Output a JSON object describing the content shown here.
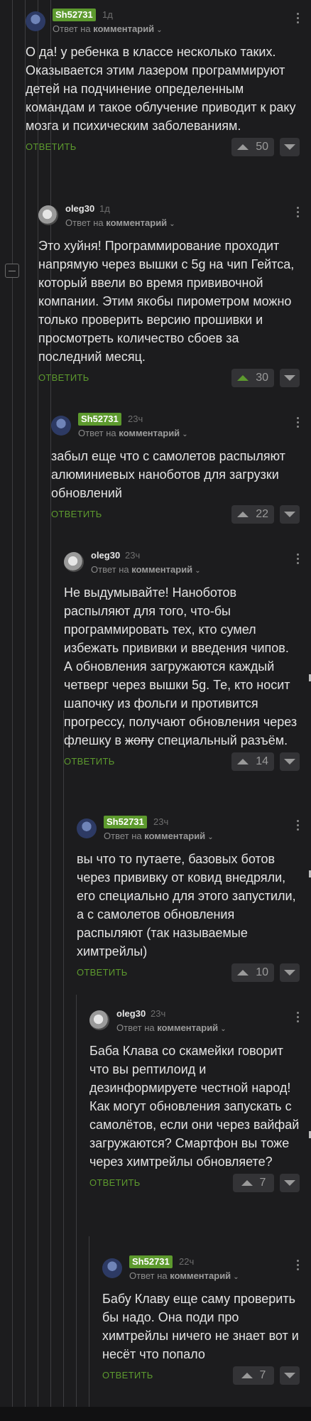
{
  "labels": {
    "reply_to": "Ответ на",
    "reply_target": "комментарий",
    "answer": "ОТВЕТИТЬ"
  },
  "comments": [
    {
      "user": "Sh52731",
      "time": "1д",
      "text": "О да! у ребенка в классе несколько таких. Оказывается этим лазером программируют детей на подчинение определенным командам и такое облучение приводит к раку мозга и психическим заболеваниям.",
      "score": "50",
      "upvoted": false
    },
    {
      "user": "oleg30",
      "time": "1д",
      "text": "Это хуйня! Программирование проходит напрямую через вышки с 5g на чип Гейтса, который ввели во время прививочной компании. Этим якобы пирометром можно только проверить версию прошивки и просмотреть количество сбоев за последний месяц.",
      "score": "30",
      "upvoted": true
    },
    {
      "user": "Sh52731",
      "time": "23ч",
      "text": "забыл еще что с самолетов распыляют алюминиевых наноботов для загрузки обновлений",
      "score": "22",
      "upvoted": false
    },
    {
      "user": "oleg30",
      "time": "23ч",
      "text_before": "Не выдумывайте! Наноботов распыляют для того, что-бы программировать тех, кто сумел избежать прививки и введения чипов. А обновления загружаются каждый четверг через вышки 5g. Те, кто носит шапочку из фольги и противится прогрессу, получают обновления через флешку в ",
      "text_strike": "жопу",
      "text_after": " специальный разъём.",
      "score": "14",
      "upvoted": false
    },
    {
      "user": "Sh52731",
      "time": "23ч",
      "text": "вы что то путаете, базовых ботов через прививку от ковид внедряли, его специально для этого запустили, а с самолетов обновления распыляют (так называемые химтрейлы)",
      "score": "10",
      "upvoted": false
    },
    {
      "user": "oleg30",
      "time": "23ч",
      "text": "Баба Клава со скамейки говорит что вы рептилоид и дезинформируете честной народ!\nКак могут обновления запускать с самолётов, если они через вайфай загружаются? Смартфон вы тоже через химтрейлы обновляете?",
      "score": "7",
      "upvoted": false
    },
    {
      "user": "Sh52731",
      "time": "22ч",
      "text": "Бабу Клаву еще саму проверить бы надо. Она поди про химтрейлы ничего не знает вот и несёт что попало",
      "score": "7",
      "upvoted": false
    }
  ]
}
